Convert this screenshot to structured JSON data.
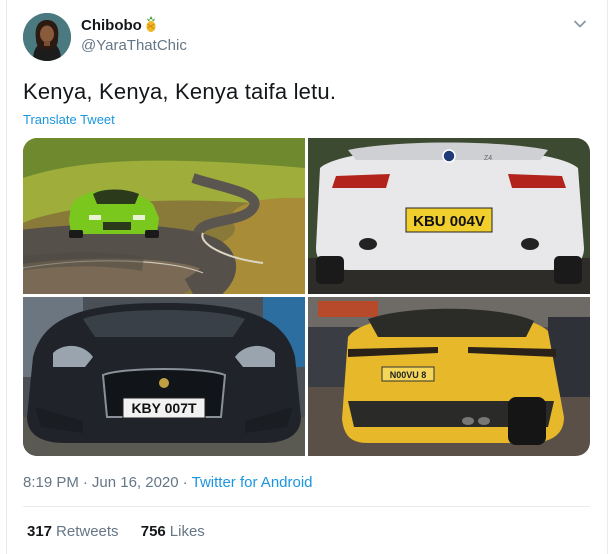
{
  "tweet": {
    "author": {
      "display_name": "Chibobo",
      "badge_emoji": "pineapple-icon",
      "handle": "@YaraThatChic"
    },
    "text": "Kenya, Kenya, Kenya taifa letu.",
    "translate_label": "Translate Tweet",
    "media": [
      {
        "name": "green-lamborghini-photo"
      },
      {
        "name": "white-bmw-photo",
        "plate": "KBU 004V"
      },
      {
        "name": "black-jaguar-photo",
        "plate": "KBY 007T"
      },
      {
        "name": "yellow-lamborghini-urus-photo",
        "plate": "N00VU 8"
      }
    ],
    "timestamp": {
      "time": "8:19 PM",
      "separator": "·",
      "date": "Jun 16, 2020",
      "source": "Twitter for Android"
    },
    "stats": {
      "retweets_count": "317",
      "retweets_label": "Retweets",
      "likes_count": "756",
      "likes_label": "Likes"
    }
  },
  "colors": {
    "link": "#1b95e0",
    "secondary_text": "#657786",
    "primary_text": "#14171a",
    "divider": "#e6ecf0"
  }
}
